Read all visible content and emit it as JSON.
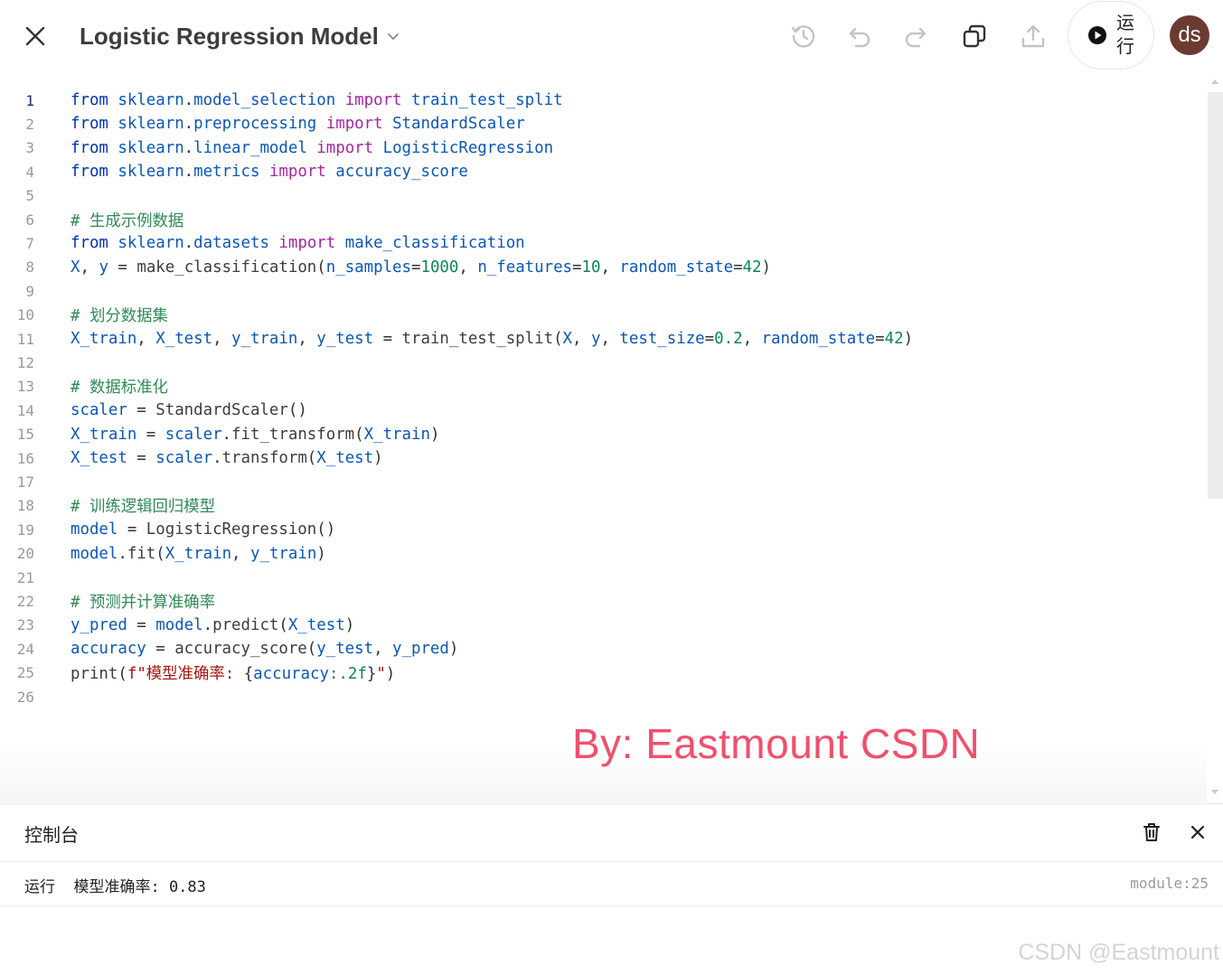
{
  "header": {
    "title": "Logistic Regression Model",
    "run_label": "运行",
    "avatar_text": "ds"
  },
  "icons": {
    "close": "close-icon",
    "dropdown": "chevron-down-icon",
    "history": "history-icon",
    "undo": "undo-icon",
    "redo": "redo-icon",
    "copy": "copy-icon",
    "export": "upload-icon",
    "run": "play-icon",
    "trash": "trash-icon"
  },
  "editor": {
    "active_line": 1,
    "lines": [
      [
        [
          "kw",
          "from"
        ],
        [
          "plain",
          " "
        ],
        [
          "var",
          "sklearn"
        ],
        [
          "plain",
          "."
        ],
        [
          "var",
          "model_selection"
        ],
        [
          "plain",
          " "
        ],
        [
          "imp",
          "import"
        ],
        [
          "plain",
          " "
        ],
        [
          "var",
          "train_test_split"
        ]
      ],
      [
        [
          "kw",
          "from"
        ],
        [
          "plain",
          " "
        ],
        [
          "var",
          "sklearn"
        ],
        [
          "plain",
          "."
        ],
        [
          "var",
          "preprocessing"
        ],
        [
          "plain",
          " "
        ],
        [
          "imp",
          "import"
        ],
        [
          "plain",
          " "
        ],
        [
          "var",
          "StandardScaler"
        ]
      ],
      [
        [
          "kw",
          "from"
        ],
        [
          "plain",
          " "
        ],
        [
          "var",
          "sklearn"
        ],
        [
          "plain",
          "."
        ],
        [
          "var",
          "linear_model"
        ],
        [
          "plain",
          " "
        ],
        [
          "imp",
          "import"
        ],
        [
          "plain",
          " "
        ],
        [
          "var",
          "LogisticRegression"
        ]
      ],
      [
        [
          "kw",
          "from"
        ],
        [
          "plain",
          " "
        ],
        [
          "var",
          "sklearn"
        ],
        [
          "plain",
          "."
        ],
        [
          "var",
          "metrics"
        ],
        [
          "plain",
          " "
        ],
        [
          "imp",
          "import"
        ],
        [
          "plain",
          " "
        ],
        [
          "var",
          "accuracy_score"
        ]
      ],
      [],
      [
        [
          "com",
          "# 生成示例数据"
        ]
      ],
      [
        [
          "kw",
          "from"
        ],
        [
          "plain",
          " "
        ],
        [
          "var",
          "sklearn"
        ],
        [
          "plain",
          "."
        ],
        [
          "var",
          "datasets"
        ],
        [
          "plain",
          " "
        ],
        [
          "imp",
          "import"
        ],
        [
          "plain",
          " "
        ],
        [
          "var",
          "make_classification"
        ]
      ],
      [
        [
          "var",
          "X"
        ],
        [
          "plain",
          ", "
        ],
        [
          "var",
          "y"
        ],
        [
          "plain",
          " = "
        ],
        [
          "fn",
          "make_classification"
        ],
        [
          "plain",
          "("
        ],
        [
          "var",
          "n_samples"
        ],
        [
          "plain",
          "="
        ],
        [
          "num",
          "1000"
        ],
        [
          "plain",
          ", "
        ],
        [
          "var",
          "n_features"
        ],
        [
          "plain",
          "="
        ],
        [
          "num",
          "10"
        ],
        [
          "plain",
          ", "
        ],
        [
          "var",
          "random_state"
        ],
        [
          "plain",
          "="
        ],
        [
          "num",
          "42"
        ],
        [
          "plain",
          ")"
        ]
      ],
      [],
      [
        [
          "com",
          "# 划分数据集"
        ]
      ],
      [
        [
          "var",
          "X_train"
        ],
        [
          "plain",
          ", "
        ],
        [
          "var",
          "X_test"
        ],
        [
          "plain",
          ", "
        ],
        [
          "var",
          "y_train"
        ],
        [
          "plain",
          ", "
        ],
        [
          "var",
          "y_test"
        ],
        [
          "plain",
          " = "
        ],
        [
          "fn",
          "train_test_split"
        ],
        [
          "plain",
          "("
        ],
        [
          "var",
          "X"
        ],
        [
          "plain",
          ", "
        ],
        [
          "var",
          "y"
        ],
        [
          "plain",
          ", "
        ],
        [
          "var",
          "test_size"
        ],
        [
          "plain",
          "="
        ],
        [
          "num",
          "0.2"
        ],
        [
          "plain",
          ", "
        ],
        [
          "var",
          "random_state"
        ],
        [
          "plain",
          "="
        ],
        [
          "num",
          "42"
        ],
        [
          "plain",
          ")"
        ]
      ],
      [],
      [
        [
          "com",
          "# 数据标准化"
        ]
      ],
      [
        [
          "var",
          "scaler"
        ],
        [
          "plain",
          " = "
        ],
        [
          "fn",
          "StandardScaler"
        ],
        [
          "plain",
          "()"
        ]
      ],
      [
        [
          "var",
          "X_train"
        ],
        [
          "plain",
          " = "
        ],
        [
          "var",
          "scaler"
        ],
        [
          "plain",
          "."
        ],
        [
          "fn",
          "fit_transform"
        ],
        [
          "plain",
          "("
        ],
        [
          "var",
          "X_train"
        ],
        [
          "plain",
          ")"
        ]
      ],
      [
        [
          "var",
          "X_test"
        ],
        [
          "plain",
          " = "
        ],
        [
          "var",
          "scaler"
        ],
        [
          "plain",
          "."
        ],
        [
          "fn",
          "transform"
        ],
        [
          "plain",
          "("
        ],
        [
          "var",
          "X_test"
        ],
        [
          "plain",
          ")"
        ]
      ],
      [],
      [
        [
          "com",
          "# 训练逻辑回归模型"
        ]
      ],
      [
        [
          "var",
          "model"
        ],
        [
          "plain",
          " = "
        ],
        [
          "fn",
          "LogisticRegression"
        ],
        [
          "plain",
          "()"
        ]
      ],
      [
        [
          "var",
          "model"
        ],
        [
          "plain",
          "."
        ],
        [
          "fn",
          "fit"
        ],
        [
          "plain",
          "("
        ],
        [
          "var",
          "X_train"
        ],
        [
          "plain",
          ", "
        ],
        [
          "var",
          "y_train"
        ],
        [
          "plain",
          ")"
        ]
      ],
      [],
      [
        [
          "com",
          "# 预测并计算准确率"
        ]
      ],
      [
        [
          "var",
          "y_pred"
        ],
        [
          "plain",
          " = "
        ],
        [
          "var",
          "model"
        ],
        [
          "plain",
          "."
        ],
        [
          "fn",
          "predict"
        ],
        [
          "plain",
          "("
        ],
        [
          "var",
          "X_test"
        ],
        [
          "plain",
          ")"
        ]
      ],
      [
        [
          "var",
          "accuracy"
        ],
        [
          "plain",
          " = "
        ],
        [
          "fn",
          "accuracy_score"
        ],
        [
          "plain",
          "("
        ],
        [
          "var",
          "y_test"
        ],
        [
          "plain",
          ", "
        ],
        [
          "var",
          "y_pred"
        ],
        [
          "plain",
          ")"
        ]
      ],
      [
        [
          "fn",
          "print"
        ],
        [
          "plain",
          "("
        ],
        [
          "str",
          "f\"模型准确率: "
        ],
        [
          "plain",
          "{"
        ],
        [
          "var",
          "accuracy"
        ],
        [
          "num",
          ":.2f"
        ],
        [
          "plain",
          "}"
        ],
        [
          "str",
          "\""
        ],
        [
          "plain",
          ")"
        ]
      ],
      []
    ]
  },
  "watermark": "By:  Eastmount CSDN",
  "console": {
    "title": "控制台",
    "output": "运行  模型准确率: 0.83",
    "source": "module:25"
  },
  "footer_mark": "CSDN @Eastmount"
}
